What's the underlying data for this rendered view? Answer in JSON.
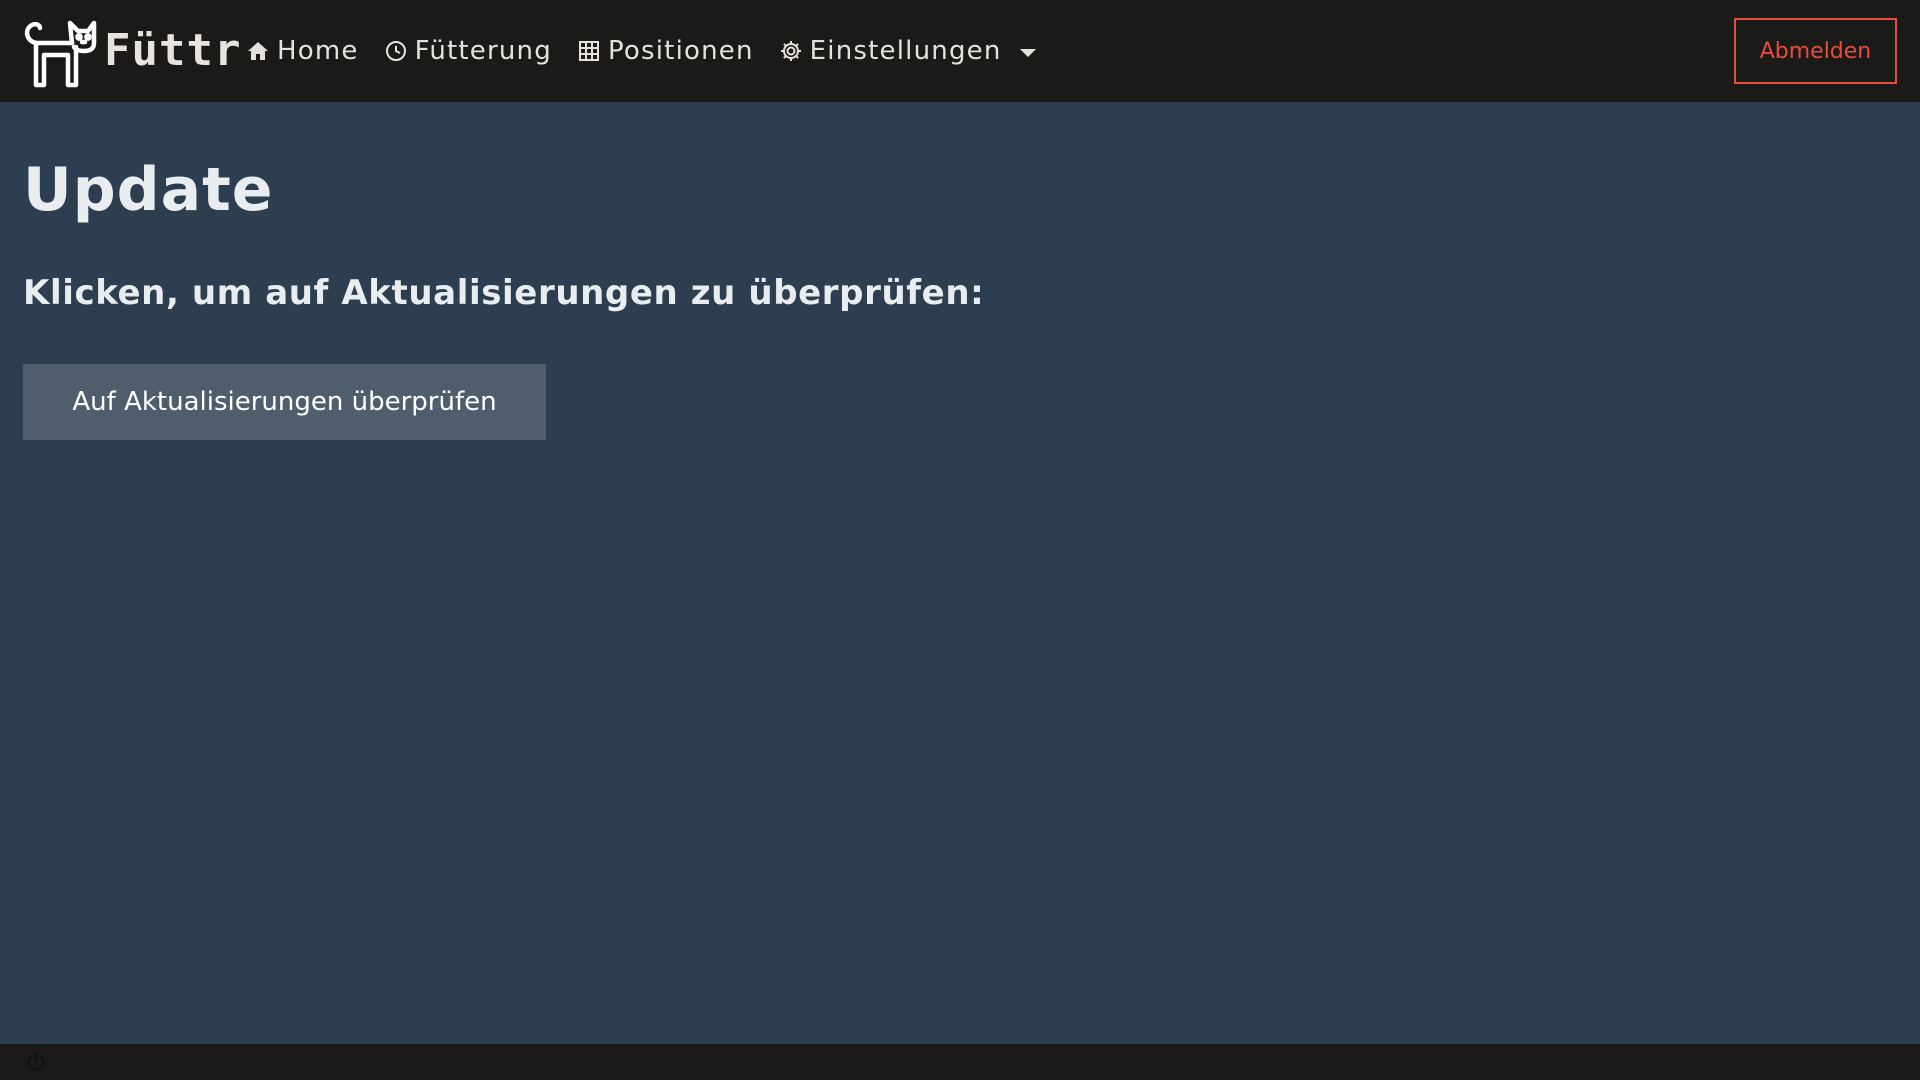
{
  "brand": {
    "name": "Füttr",
    "logo_icon": "cat-icon"
  },
  "nav": {
    "items": [
      {
        "label": "Home",
        "icon": "home-icon"
      },
      {
        "label": "Fütterung",
        "icon": "clock-icon"
      },
      {
        "label": "Positionen",
        "icon": "grid-icon"
      },
      {
        "label": "Einstellungen",
        "icon": "gear-icon",
        "has_dropdown": true
      }
    ],
    "logout_label": "Abmelden"
  },
  "main": {
    "title": "Update",
    "subtitle": "Klicken, um auf Aktualisierungen zu überprüfen:",
    "check_button_label": "Auf Aktualisierungen überprüfen"
  },
  "footer": {
    "icon": "power-icon"
  },
  "colors": {
    "navbar_bg": "#1b1a19",
    "page_bg": "#2c3e50",
    "button_bg": "#4f5d6d",
    "logout_accent": "#e74c3c",
    "text_light": "#e9edf0"
  }
}
